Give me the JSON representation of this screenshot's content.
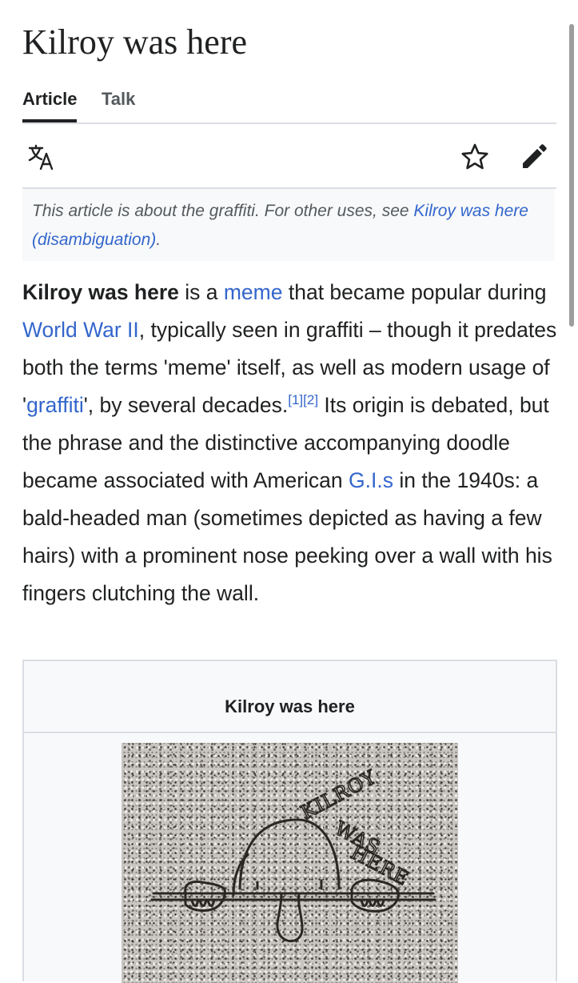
{
  "page": {
    "title": "Kilroy was here"
  },
  "tabs": [
    {
      "label": "Article",
      "active": true
    },
    {
      "label": "Talk",
      "active": false
    }
  ],
  "toolbar": {
    "icons": [
      "language-icon",
      "star-icon",
      "edit-pencil-icon"
    ]
  },
  "hatnote": {
    "text": "This article is about the graffiti. For other uses, see ",
    "link": "Kilroy was here (disambiguation)",
    "end": "."
  },
  "lead": {
    "bold": "Kilroy was here",
    "t1": " is a ",
    "link_meme": "meme",
    "t2": " that became popular during ",
    "link_ww2": "World War II",
    "t3": ", typically seen in graffiti – though it predates both the terms 'meme' itself, as well as modern usage of '",
    "link_graffiti": "graffiti",
    "t4": "', by several decades.",
    "ref1": "[1]",
    "ref2": "[2]",
    "t5": " Its origin is debated, but the phrase and the distinctive accompanying doodle became associated with American ",
    "link_gis": "G.I.s",
    "t6": " in the 1940s: a bald-headed man (sometimes depicted as having a few hairs) with a prominent nose peeking over a wall with his fingers clutching the wall."
  },
  "infobox": {
    "title": "Kilroy was here",
    "image_text": [
      "KILROY",
      "WAS",
      "HERE"
    ]
  },
  "colors": {
    "link": "#3366cc",
    "text": "#202122",
    "muted": "#54595d",
    "border": "#dadde3",
    "panel": "#f8f9fa"
  }
}
